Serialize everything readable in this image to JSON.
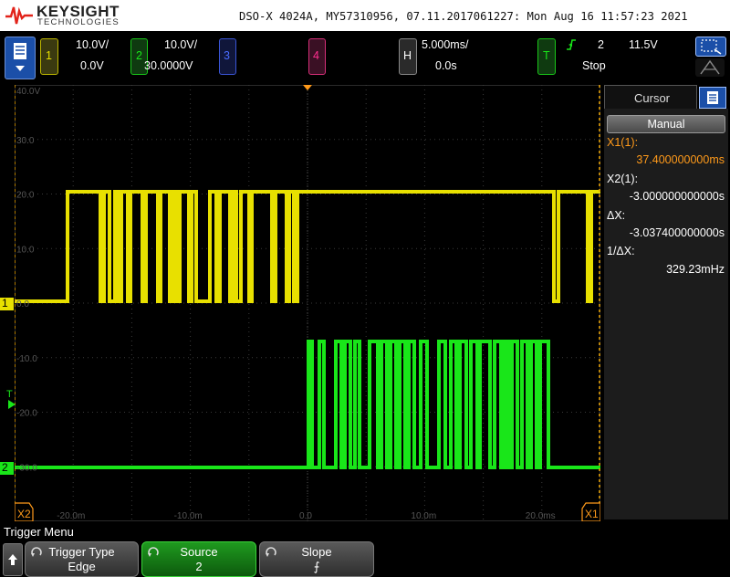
{
  "header": {
    "brand": "KEYSIGHT",
    "brand_sub": "TECHNOLOGIES",
    "info": "DSO-X 4024A, MY57310956, 07.11.2017061227: Mon Aug 16 11:57:23 2021"
  },
  "channels": [
    {
      "num": "1",
      "scale": "10.0V/",
      "offset": "0.0V",
      "color": "#e8e000"
    },
    {
      "num": "2",
      "scale": "10.0V/",
      "offset": "30.0000V",
      "color": "#19e619"
    },
    {
      "num": "3",
      "color": "#4a6cff"
    },
    {
      "num": "4",
      "color": "#ff2f8f"
    }
  ],
  "horizontal": {
    "label": "H",
    "scale": "5.000ms/",
    "position": "0.0s"
  },
  "trigger": {
    "label": "T",
    "source": "2",
    "level": "11.5V",
    "mode": "Stop"
  },
  "plot": {
    "y_labels": [
      "40.0V",
      "30.0",
      "20.0",
      "10.0",
      "0.0",
      "-10.0",
      "-20.0",
      "-30.0"
    ],
    "x_labels": [
      "-20.0m",
      "-10.0m",
      "0.0",
      "10.0m",
      "20.0ms"
    ],
    "marker_x1": "X1",
    "marker_x2": "X2",
    "ch1_marker": "1",
    "ch2_marker": "2",
    "trig_marker": "T"
  },
  "cursor_panel": {
    "title": "Cursor",
    "mode_button": "Manual",
    "x1_label": "X1(1):",
    "x1_value": "37.400000000ms",
    "x2_label": "X2(1):",
    "x2_value": "-3.000000000000s",
    "dx_label": "ΔX:",
    "dx_value": "-3.037400000000s",
    "inv_dx_label": "1/ΔX:",
    "inv_dx_value": "329.23mHz"
  },
  "menu": {
    "title": "Trigger Menu",
    "softkeys": [
      {
        "label": "Trigger Type",
        "value": "Edge"
      },
      {
        "label": "Source",
        "value": "2"
      },
      {
        "label": "Slope",
        "value": "⨍"
      }
    ]
  }
}
